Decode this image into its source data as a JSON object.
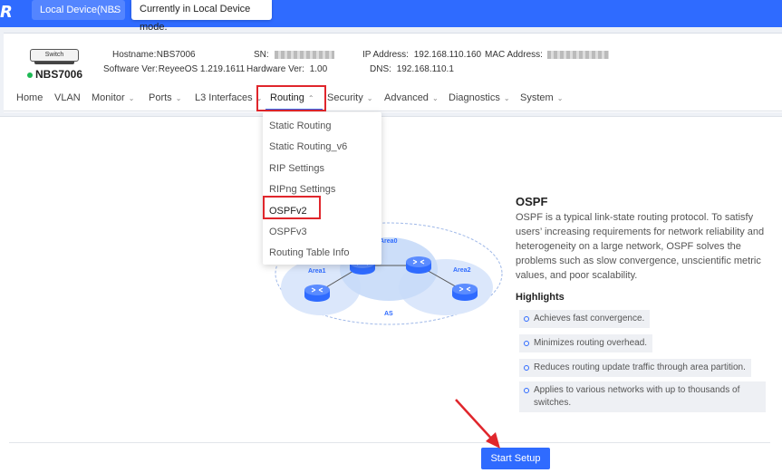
{
  "topbar": {
    "logo": "R",
    "device_select": "Local Device(NBS",
    "mode_tip": "Currently in Local Device mode."
  },
  "device": {
    "icon_label": "Switch",
    "name": "NBS7006",
    "hostname_label": "Hostname:",
    "hostname": "NBS7006",
    "software_label": "Software Ver:",
    "software": "ReyeeOS 1.219.1611",
    "sn_label": "SN:",
    "hardware_label": "Hardware Ver:",
    "hardware": "1.00",
    "ip_label": "IP Address:",
    "ip": "192.168.110.160",
    "dns_label": "DNS:",
    "dns": "192.168.110.1",
    "mac_label": "MAC Address:"
  },
  "nav": {
    "items": [
      "Home",
      "VLAN",
      "Monitor",
      "Ports",
      "L3 Interfaces",
      "Routing",
      "Security",
      "Advanced",
      "Diagnostics",
      "System"
    ]
  },
  "dropdown": {
    "items": [
      "Static Routing",
      "Static Routing_v6",
      "RIP Settings",
      "RIPng Settings",
      "OSPFv2",
      "OSPFv3",
      "Routing Table Info"
    ]
  },
  "diagram": {
    "area0": "Area0",
    "area1": "Area1",
    "area2": "Area2",
    "as": "AS"
  },
  "ospf": {
    "title": "OSPF",
    "description": "OSPF is a typical link-state routing protocol. To satisfy users’ increasing requirements for network reliability and heterogeneity on a large network, OSPF solves the problems such as slow convergence, unscientific metric values, and poor scalability.",
    "highlights_title": "Highlights",
    "highlights": [
      "Achieves fast convergence.",
      "Minimizes routing overhead.",
      "Reduces routing update traffic through area partition.",
      "Applies to various networks with up to thousands of switches."
    ],
    "start_button": "Start Setup"
  },
  "colors": {
    "primary": "#2f6bff",
    "highlight_box": "#e0262c"
  }
}
